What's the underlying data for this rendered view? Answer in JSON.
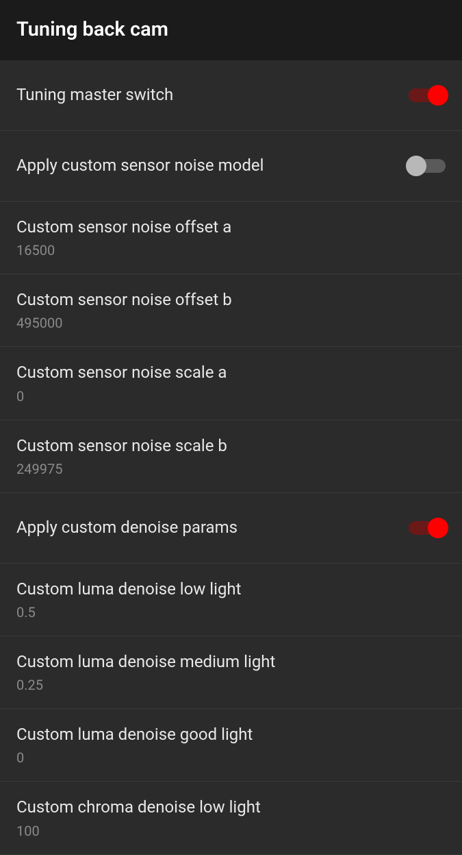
{
  "header": {
    "title": "Tuning back cam"
  },
  "settings": [
    {
      "label": "Tuning master switch",
      "type": "toggle",
      "state": "on"
    },
    {
      "label": "Apply custom sensor noise model",
      "type": "toggle",
      "state": "off"
    },
    {
      "label": "Custom sensor noise offset a",
      "type": "value",
      "value": "16500"
    },
    {
      "label": "Custom sensor noise offset b",
      "type": "value",
      "value": "495000"
    },
    {
      "label": "Custom sensor noise scale a",
      "type": "value",
      "value": "0"
    },
    {
      "label": "Custom sensor noise scale b",
      "type": "value",
      "value": "249975"
    },
    {
      "label": "Apply custom denoise params",
      "type": "toggle",
      "state": "on"
    },
    {
      "label": "Custom luma denoise low light",
      "type": "value",
      "value": "0.5"
    },
    {
      "label": "Custom luma denoise medium light",
      "type": "value",
      "value": "0.25"
    },
    {
      "label": "Custom luma denoise good light",
      "type": "value",
      "value": "0"
    },
    {
      "label": "Custom chroma denoise low light",
      "type": "value",
      "value": "100"
    }
  ]
}
